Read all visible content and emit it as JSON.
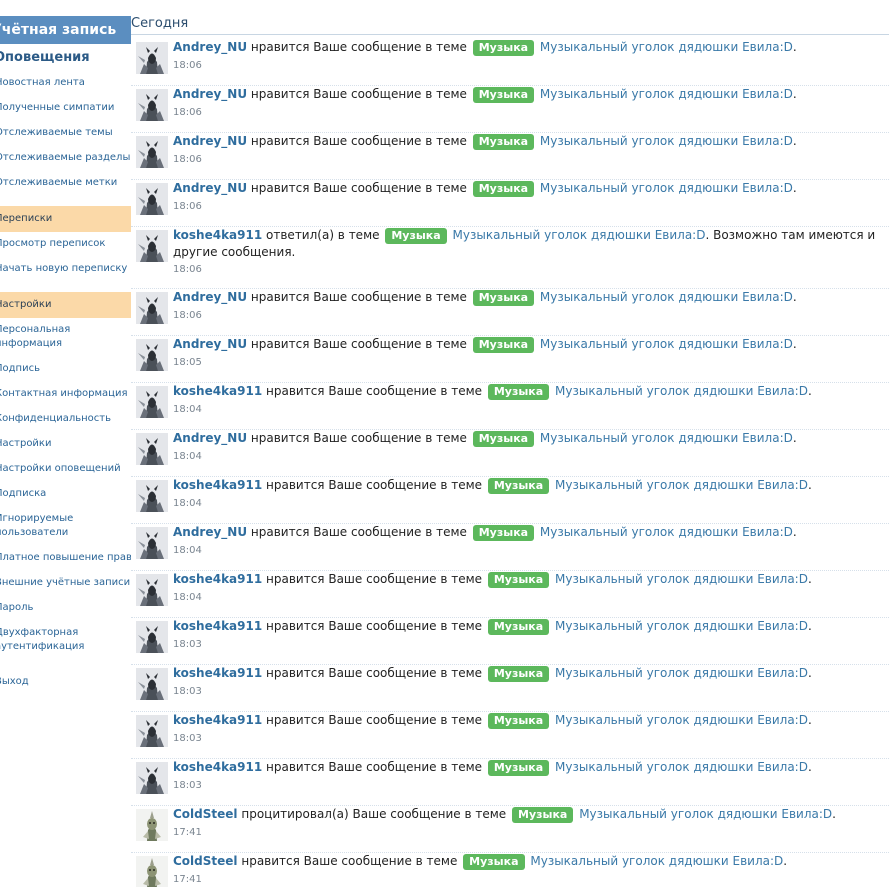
{
  "sidebar": {
    "title": "Учётная запись",
    "section_title": "Оповещения",
    "items": [
      {
        "label": "Новостная лента"
      },
      {
        "label": "Полученные симпатии"
      },
      {
        "label": "Отслеживаемые темы"
      },
      {
        "label": "Отслеживаемые разделы"
      },
      {
        "label": "Отслеживаемые метки"
      },
      {
        "label": "Переписки"
      },
      {
        "label": "Просмотр переписок"
      },
      {
        "label": "Начать новую переписку"
      },
      {
        "label": "Настройки"
      },
      {
        "label": "Персональная информация"
      },
      {
        "label": "Подпись"
      },
      {
        "label": "Контактная информация"
      },
      {
        "label": "Конфиденциальность"
      },
      {
        "label": "Настройки"
      },
      {
        "label": "Настройки оповещений"
      },
      {
        "label": "Подписка"
      },
      {
        "label": "Игнорируемые пользователи"
      },
      {
        "label": "Платное повышение прав"
      },
      {
        "label": "Внешние учётные записи"
      },
      {
        "label": "Пароль"
      },
      {
        "label": "Двухфакторная аутентификация"
      },
      {
        "label": "Выход"
      }
    ]
  },
  "main": {
    "day_heading": "Сегодня",
    "alerts": [
      {
        "user": "Andrey_NU",
        "action": "нравится Ваше сообщение в теме",
        "prefix": "Музыка",
        "thread": "Музыкальный уголок дядюшки Евила:D",
        "tail": ".",
        "time": "18:06",
        "avatar": "knight-avatar"
      },
      {
        "user": "Andrey_NU",
        "action": "нравится Ваше сообщение в теме",
        "prefix": "Музыка",
        "thread": "Музыкальный уголок дядюшки Евила:D",
        "tail": ".",
        "time": "18:06",
        "avatar": "knight-avatar"
      },
      {
        "user": "Andrey_NU",
        "action": "нравится Ваше сообщение в теме",
        "prefix": "Музыка",
        "thread": "Музыкальный уголок дядюшки Евила:D",
        "tail": ".",
        "time": "18:06",
        "avatar": "knight-avatar"
      },
      {
        "user": "Andrey_NU",
        "action": "нравится Ваше сообщение в теме",
        "prefix": "Музыка",
        "thread": "Музыкальный уголок дядюшки Евила:D",
        "tail": ".",
        "time": "18:06",
        "avatar": "knight-avatar"
      },
      {
        "user": "koshe4ka911",
        "action": "ответил(а) в теме",
        "prefix": "Музыка",
        "thread": "Музыкальный уголок дядюшки Евила:D",
        "tail": ". Возможно там имеются и другие сообщения.",
        "time": "18:06",
        "avatar": "knight-avatar"
      },
      {
        "user": "Andrey_NU",
        "action": "нравится Ваше сообщение в теме",
        "prefix": "Музыка",
        "thread": "Музыкальный уголок дядюшки Евила:D",
        "tail": ".",
        "time": "18:06",
        "avatar": "knight-avatar"
      },
      {
        "user": "Andrey_NU",
        "action": "нравится Ваше сообщение в теме",
        "prefix": "Музыка",
        "thread": "Музыкальный уголок дядюшки Евила:D",
        "tail": ".",
        "time": "18:05",
        "avatar": "knight-avatar"
      },
      {
        "user": "koshe4ka911",
        "action": "нравится Ваше сообщение в теме",
        "prefix": "Музыка",
        "thread": "Музыкальный уголок дядюшки Евила:D",
        "tail": ".",
        "time": "18:04",
        "avatar": "knight-avatar"
      },
      {
        "user": "Andrey_NU",
        "action": "нравится Ваше сообщение в теме",
        "prefix": "Музыка",
        "thread": "Музыкальный уголок дядюшки Евила:D",
        "tail": ".",
        "time": "18:04",
        "avatar": "knight-avatar"
      },
      {
        "user": "koshe4ka911",
        "action": "нравится Ваше сообщение в теме",
        "prefix": "Музыка",
        "thread": "Музыкальный уголок дядюшки Евила:D",
        "tail": ".",
        "time": "18:04",
        "avatar": "knight-avatar"
      },
      {
        "user": "Andrey_NU",
        "action": "нравится Ваше сообщение в теме",
        "prefix": "Музыка",
        "thread": "Музыкальный уголок дядюшки Евила:D",
        "tail": ".",
        "time": "18:04",
        "avatar": "knight-avatar"
      },
      {
        "user": "koshe4ka911",
        "action": "нравится Ваше сообщение в теме",
        "prefix": "Музыка",
        "thread": "Музыкальный уголок дядюшки Евила:D",
        "tail": ".",
        "time": "18:04",
        "avatar": "knight-avatar"
      },
      {
        "user": "koshe4ka911",
        "action": "нравится Ваше сообщение в теме",
        "prefix": "Музыка",
        "thread": "Музыкальный уголок дядюшки Евила:D",
        "tail": ".",
        "time": "18:03",
        "avatar": "knight-avatar"
      },
      {
        "user": "koshe4ka911",
        "action": "нравится Ваше сообщение в теме",
        "prefix": "Музыка",
        "thread": "Музыкальный уголок дядюшки Евила:D",
        "tail": ".",
        "time": "18:03",
        "avatar": "knight-avatar"
      },
      {
        "user": "koshe4ka911",
        "action": "нравится Ваше сообщение в теме",
        "prefix": "Музыка",
        "thread": "Музыкальный уголок дядюшки Евила:D",
        "tail": ".",
        "time": "18:03",
        "avatar": "knight-avatar"
      },
      {
        "user": "koshe4ka911",
        "action": "нравится Ваше сообщение в теме",
        "prefix": "Музыка",
        "thread": "Музыкальный уголок дядюшки Евила:D",
        "tail": ".",
        "time": "18:03",
        "avatar": "knight-avatar"
      },
      {
        "user": "ColdSteel",
        "action": "процитировал(а) Ваше сообщение в теме",
        "prefix": "Музыка",
        "thread": "Музыкальный уголок дядюшки Евила:D",
        "tail": ".",
        "time": "17:41",
        "avatar": "creature-avatar"
      },
      {
        "user": "ColdSteel",
        "action": "нравится Ваше сообщение в теме",
        "prefix": "Музыка",
        "thread": "Музыкальный уголок дядюшки Евила:D",
        "tail": ".",
        "time": "17:41",
        "avatar": "creature-avatar"
      }
    ]
  }
}
